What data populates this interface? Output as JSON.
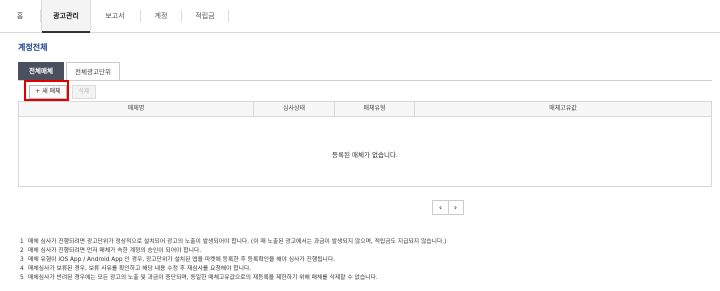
{
  "topnav": {
    "tabs": [
      {
        "label": "홈"
      },
      {
        "label": "광고관리"
      },
      {
        "label": "보고서"
      },
      {
        "label": "계정"
      },
      {
        "label": "적립금"
      }
    ]
  },
  "section": {
    "title": "계정전체"
  },
  "subtabs": [
    {
      "label": "전체매체"
    },
    {
      "label": "전체광고단위"
    }
  ],
  "toolbar": {
    "new_button": "+ 새 매체",
    "disabled_button": "삭제"
  },
  "table": {
    "columns": [
      "매체명",
      "심사상태",
      "매체유형",
      "매체고유값"
    ],
    "empty_message": "등록된 매체가 없습니다."
  },
  "pager": {
    "prev": "‹",
    "next": "›"
  },
  "notes": [
    {
      "num": "1",
      "text": "매체 심사가 진행되려면 광고단위가 정상적으로 설치되어 광고의 노출이 발생되어야 합니다. (이 때 노출된 광고에서는 과금이 발생되지 않으며, 적립금도 지급되지 않습니다.)"
    },
    {
      "num": "2",
      "text": "매체 심사가 진행되려면 먼저 매체가 속한 계정의 승인이 되어야 합니다."
    },
    {
      "num": "3",
      "text": "매체 유형이 iOS App / Android App 인 경우, 광고단위가 설치된 앱을 마켓에 등록한 후 등록확인을 해야 심사가 진행됩니다."
    },
    {
      "num": "4",
      "text": "매체심사가 보류된 경우, 보류 사유를 확인하고 해당 내용 수정 후 재심사를 요청해야 합니다."
    },
    {
      "num": "5",
      "text": "매체심사가 반려된 경우에는 모든 광고의 노출 및 과금이 중단되며, 동일한 매체고유값으로의 재등록을 제한하기 위해 매체를 삭제할 수 없습니다."
    }
  ]
}
